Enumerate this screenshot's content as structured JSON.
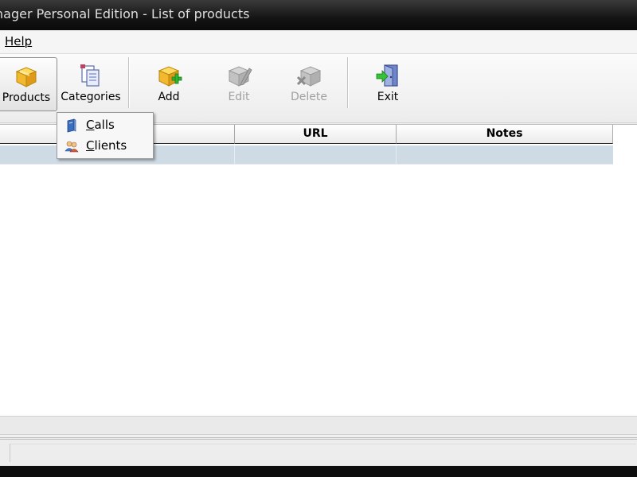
{
  "window": {
    "title": "nager Personal Edition - List of products"
  },
  "menubar": {
    "help": "Help"
  },
  "toolbar": {
    "products": "Products",
    "categories": "Categories",
    "add": "Add",
    "edit": "Edit",
    "delete": "Delete",
    "exit": "Exit"
  },
  "categories_menu": {
    "items": [
      {
        "first": "C",
        "rest": "alls",
        "icon": "book-icon"
      },
      {
        "first": "C",
        "rest": "lients",
        "icon": "people-icon"
      }
    ]
  },
  "grid": {
    "columns": [
      "",
      "",
      "URL",
      "Notes"
    ]
  },
  "colors": {
    "selected_row": "#cfdbe4",
    "title_bar": "#141414",
    "window_bg": "#f0f0f0"
  }
}
